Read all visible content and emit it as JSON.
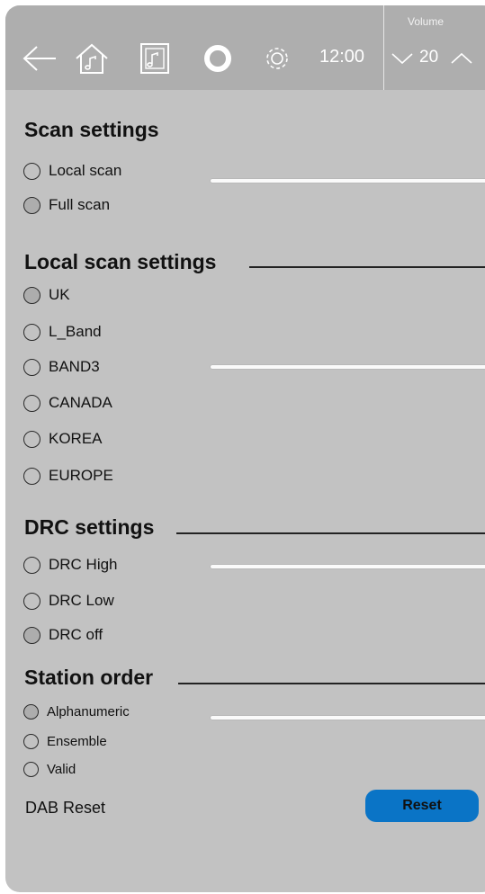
{
  "status_bar": {
    "time": "12:00",
    "volume_label": "Volume",
    "volume_value": "20"
  },
  "icons": [
    "back-arrow-icon",
    "home-icon",
    "music-icon",
    "circle-icon",
    "gear-icon",
    "chevron-down-icon",
    "chevron-up-icon"
  ],
  "scan_settings": {
    "title": "Scan settings",
    "options": [
      {
        "label": "Local scan",
        "selected": false
      },
      {
        "label": "Full scan",
        "selected": true
      }
    ]
  },
  "local_scan_settings": {
    "title": "Local scan settings",
    "options": [
      {
        "label": "UK",
        "selected": true
      },
      {
        "label": "L_Band",
        "selected": false
      },
      {
        "label": "BAND3",
        "selected": false
      },
      {
        "label": "CANADA",
        "selected": false
      },
      {
        "label": "KOREA",
        "selected": false
      },
      {
        "label": "EUROPE",
        "selected": false
      }
    ]
  },
  "drc_settings": {
    "title": "DRC settings",
    "options": [
      {
        "label": "DRC High",
        "selected": false
      },
      {
        "label": "DRC Low",
        "selected": false
      },
      {
        "label": "DRC off",
        "selected": true
      }
    ]
  },
  "station_order": {
    "title": "Station order",
    "options": [
      {
        "label": "Alphanumeric",
        "selected": true
      },
      {
        "label": "Ensemble",
        "selected": false
      },
      {
        "label": "Valid",
        "selected": false
      }
    ]
  },
  "dab_reset": {
    "label": "DAB Reset",
    "button_label": "Reset"
  },
  "colors": {
    "panel": "#c2c2c2",
    "topbar": "#aeaeae",
    "accent": "#0a74c6"
  }
}
